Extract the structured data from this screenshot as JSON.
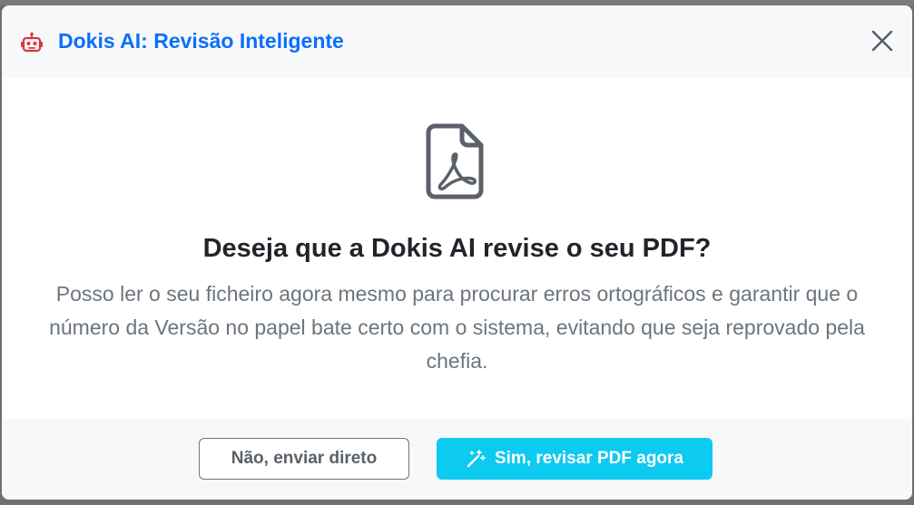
{
  "modal": {
    "title": "Dokis AI: Revisão Inteligente",
    "header_icon": "robot-icon",
    "close_icon": "close-icon",
    "body_icon": "file-pdf-icon",
    "question": "Deseja que a Dokis AI revise o seu PDF?",
    "description": "Posso ler o seu ficheiro agora mesmo para procurar erros ortográficos e garantir que o número da Versão no papel bate certo com o sistema, evitando que seja reprovado pela chefia.",
    "buttons": {
      "decline_label": "Não, enviar direto",
      "accept_label": "Sim, revisar PDF agora",
      "accept_icon": "magic-wand-icon"
    }
  },
  "colors": {
    "title": "#0d6efd",
    "accept_button": "#0dcaf0",
    "robot_icon": "#dc3545",
    "overlay": "#6f6f6f"
  }
}
